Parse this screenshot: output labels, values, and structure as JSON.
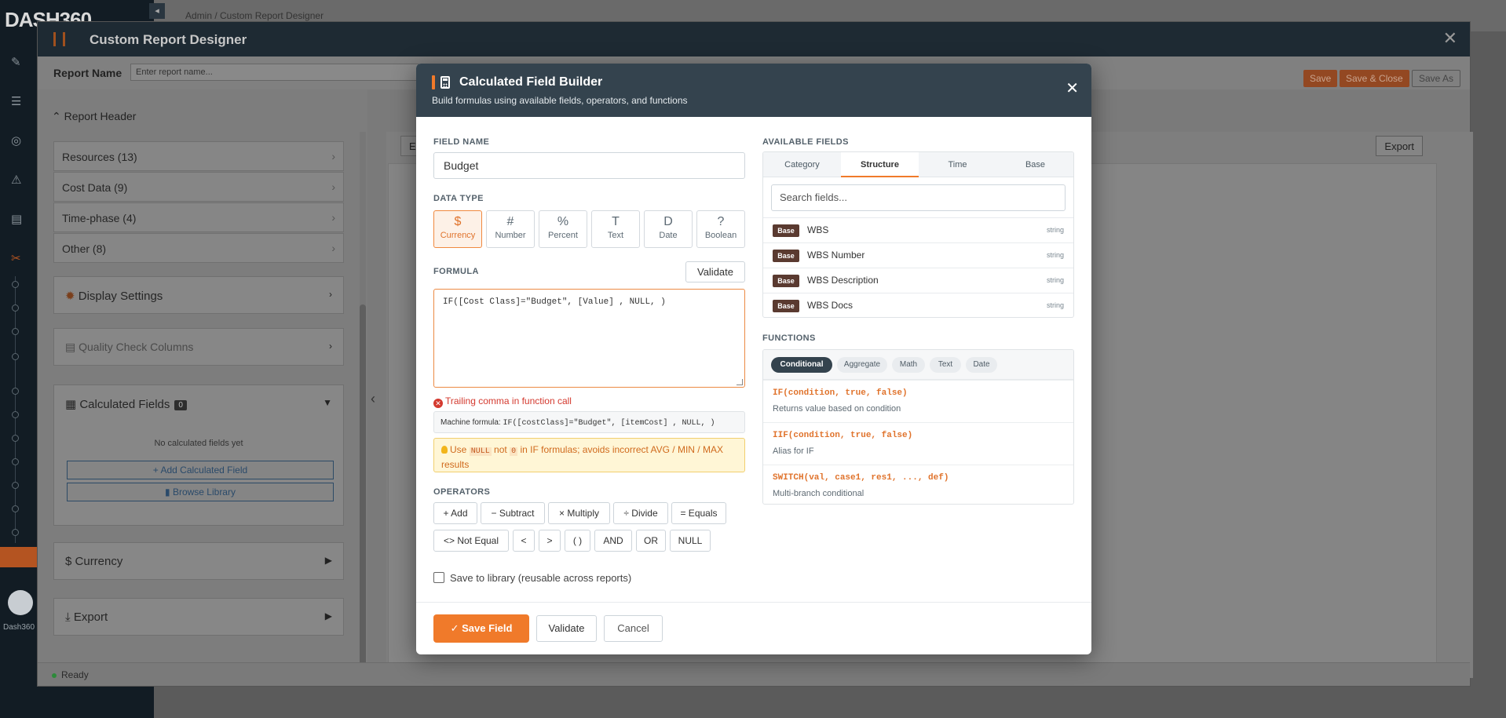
{
  "background": {
    "logo": "DASH360",
    "breadcrumb": "Admin  /  Custom Report Designer",
    "user_name": "Dash360"
  },
  "designer": {
    "title": "Custom Report Designer",
    "report_name_label": "Report Name",
    "report_name_placeholder": "Enter report name...",
    "save_label": "Save",
    "save_close_label": "Save & Close",
    "save_as_label": "Save As",
    "report_header_label": "Report Header",
    "left_rows": [
      {
        "label": "Resources (13)"
      },
      {
        "label": "Cost Data (9)"
      },
      {
        "label": "Time-phase (4)"
      },
      {
        "label": "Other (8)"
      }
    ],
    "display_settings": "Display Settings",
    "quality_check": "Quality Check Columns",
    "calculated_fields": "Calculated Fields",
    "calculated_count": "0",
    "no_calc_fields": "No calculated fields yet",
    "add_calc_field": "+ Add Calculated Field",
    "browse_library": "Browse Library",
    "currency_section": "Currency",
    "export_section": "Export",
    "export_button": "Export",
    "e_button": "E",
    "status": "Ready"
  },
  "modal": {
    "title": "Calculated Field Builder",
    "subtitle": "Build formulas using available fields, operators, and functions",
    "field_name_label": "FIELD NAME",
    "field_name_value": "Budget",
    "data_type_label": "DATA TYPE",
    "data_types": [
      {
        "symbol": "$",
        "label": "Currency",
        "active": true
      },
      {
        "symbol": "#",
        "label": "Number"
      },
      {
        "symbol": "%",
        "label": "Percent"
      },
      {
        "symbol": "T",
        "label": "Text"
      },
      {
        "symbol": "D",
        "label": "Date"
      },
      {
        "symbol": "?",
        "label": "Boolean"
      }
    ],
    "formula_label": "FORMULA",
    "validate_label": "Validate",
    "formula_text": "IF([Cost Class]=\"Budget\", [Value] , NULL, )",
    "error_text": "Trailing comma in function call",
    "machine_label": "Machine formula:",
    "machine_formula": "IF([costClass]=\"Budget\", [itemCost] , NULL, )",
    "tip": {
      "prefix": "Use",
      "code1": "NULL",
      "middle": "not",
      "code2": "0",
      "suffix": "in IF formulas; avoids incorrect AVG / MIN / MAX results"
    },
    "operators_label": "OPERATORS",
    "operators": [
      "+ Add",
      "− Subtract",
      "× Multiply",
      "÷ Divide",
      "= Equals",
      "<> Not Equal",
      "<",
      ">",
      "( )",
      "AND",
      "OR",
      "NULL"
    ],
    "save_to_library": "Save to library (reusable across reports)",
    "save_field": "Save Field",
    "cancel": "Cancel",
    "available_fields_label": "AVAILABLE FIELDS",
    "field_tabs": [
      "Category",
      "Structure",
      "Time",
      "Base"
    ],
    "active_field_tab": "Structure",
    "search_placeholder": "Search fields...",
    "fields": [
      {
        "badge": "Base",
        "name": "WBS",
        "type": "string"
      },
      {
        "badge": "Base",
        "name": "WBS Number",
        "type": "string"
      },
      {
        "badge": "Base",
        "name": "WBS Description",
        "type": "string"
      },
      {
        "badge": "Base",
        "name": "WBS Docs",
        "type": "string"
      }
    ],
    "functions_label": "FUNCTIONS",
    "function_tabs": [
      "Conditional",
      "Aggregate",
      "Math",
      "Text",
      "Date"
    ],
    "active_function_tab": "Conditional",
    "functions": [
      {
        "signature": "IF(condition, true, false)",
        "description": "Returns value based on condition"
      },
      {
        "signature": "IIF(condition, true, false)",
        "description": "Alias for IF"
      },
      {
        "signature": "SWITCH(val, case1, res1, ..., def)",
        "description": "Multi-branch conditional"
      }
    ]
  },
  "colors": {
    "accent": "#f07a2a",
    "modal_header": "#34434e",
    "error": "#d43a2f",
    "badge": "#5a3a30"
  }
}
